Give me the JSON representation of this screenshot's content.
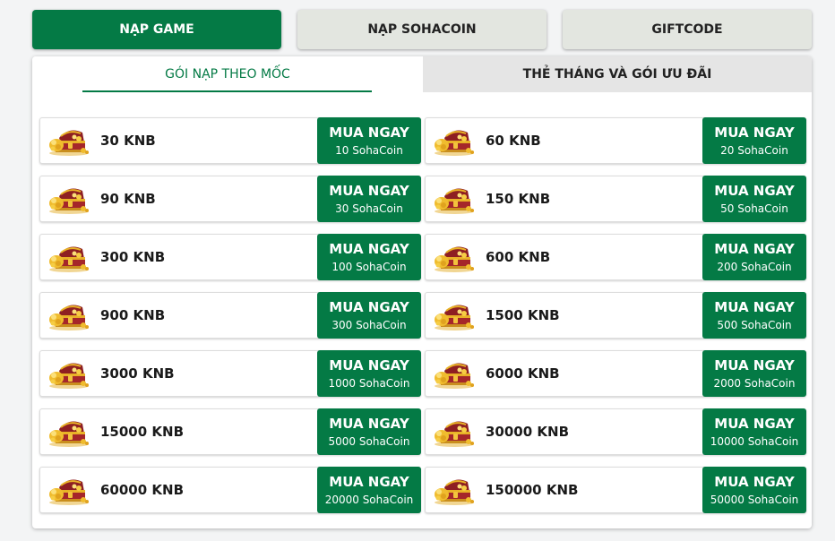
{
  "top_tabs": [
    {
      "label": "NẠP GAME",
      "active": true
    },
    {
      "label": "NẠP SOHACOIN",
      "active": false
    },
    {
      "label": "GIFTCODE",
      "active": false
    }
  ],
  "sub_tabs": [
    {
      "label": "GÓI NẠP THEO MỐC",
      "active": true
    },
    {
      "label": "THẺ THÁNG VÀ GÓI ƯU ĐÃI",
      "active": false
    }
  ],
  "buy_label": "MUA NGAY",
  "icon": "treasure-chest-icon",
  "colors": {
    "accent": "#047a45",
    "inactive_tab": "#e3e6e0",
    "chest_red": "#a5262a",
    "chest_gold": "#e8b227"
  },
  "packages": [
    {
      "amount": "30 KNB",
      "price": "10 SohaCoin"
    },
    {
      "amount": "60 KNB",
      "price": "20 SohaCoin"
    },
    {
      "amount": "90 KNB",
      "price": "30 SohaCoin"
    },
    {
      "amount": "150 KNB",
      "price": "50 SohaCoin"
    },
    {
      "amount": "300 KNB",
      "price": "100 SohaCoin"
    },
    {
      "amount": "600 KNB",
      "price": "200 SohaCoin"
    },
    {
      "amount": "900 KNB",
      "price": "300 SohaCoin"
    },
    {
      "amount": "1500 KNB",
      "price": "500 SohaCoin"
    },
    {
      "amount": "3000 KNB",
      "price": "1000 SohaCoin"
    },
    {
      "amount": "6000 KNB",
      "price": "2000 SohaCoin"
    },
    {
      "amount": "15000 KNB",
      "price": "5000 SohaCoin"
    },
    {
      "amount": "30000 KNB",
      "price": "10000 SohaCoin"
    },
    {
      "amount": "60000 KNB",
      "price": "20000 SohaCoin"
    },
    {
      "amount": "150000 KNB",
      "price": "50000 SohaCoin"
    }
  ]
}
